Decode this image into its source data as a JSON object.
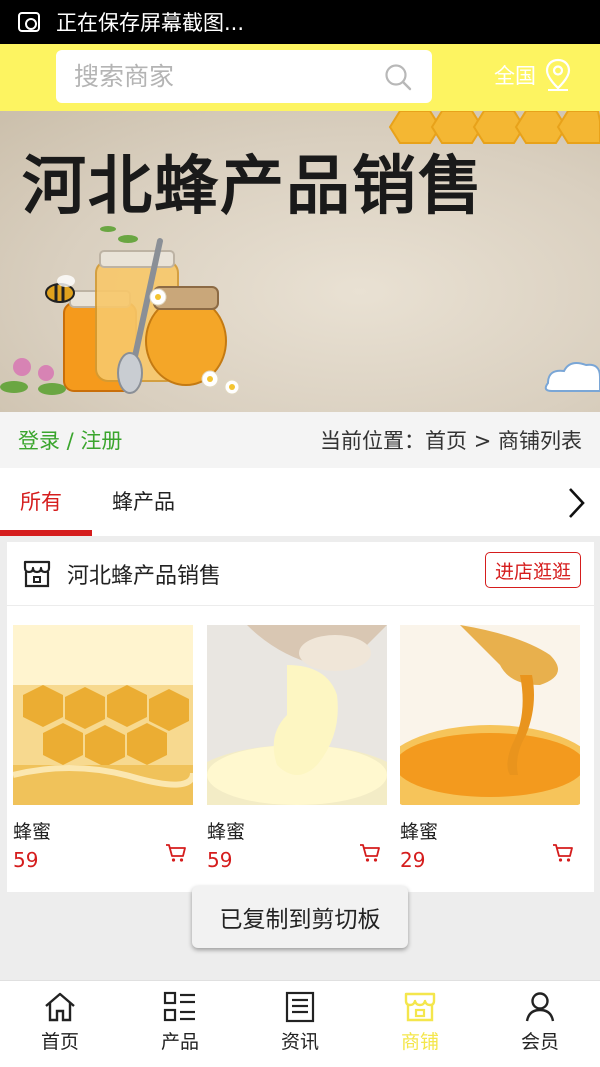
{
  "status_bar": {
    "text": "正在保存屏幕截图..."
  },
  "search": {
    "placeholder": "搜索商家"
  },
  "region": {
    "label": "全国"
  },
  "banner": {
    "title": "河北蜂产品销售"
  },
  "location_bar": {
    "login": "登录 / 注册",
    "breadcrumb": "当前位置：首页 > 商铺列表"
  },
  "tabs": [
    {
      "label": "所有",
      "active": true
    },
    {
      "label": "蜂产品",
      "active": false
    }
  ],
  "shop": {
    "name": "河北蜂产品销售",
    "visit_label": "进店逛逛",
    "products": [
      {
        "name": "蜂蜜",
        "price": "59"
      },
      {
        "name": "蜂蜜",
        "price": "59"
      },
      {
        "name": "蜂蜜",
        "price": "29"
      }
    ]
  },
  "toast": {
    "text": "已复制到剪切板"
  },
  "bottom_nav": [
    {
      "label": "首页",
      "icon": "home-icon",
      "active": false
    },
    {
      "label": "产品",
      "icon": "grid-list-icon",
      "active": false
    },
    {
      "label": "资讯",
      "icon": "news-icon",
      "active": false
    },
    {
      "label": "商铺",
      "icon": "shop-icon",
      "active": true
    },
    {
      "label": "会员",
      "icon": "user-icon",
      "active": false
    }
  ],
  "colors": {
    "accent_yellow": "#fdf461",
    "accent_red": "#d51d1d",
    "login_green": "#3aa52d"
  }
}
